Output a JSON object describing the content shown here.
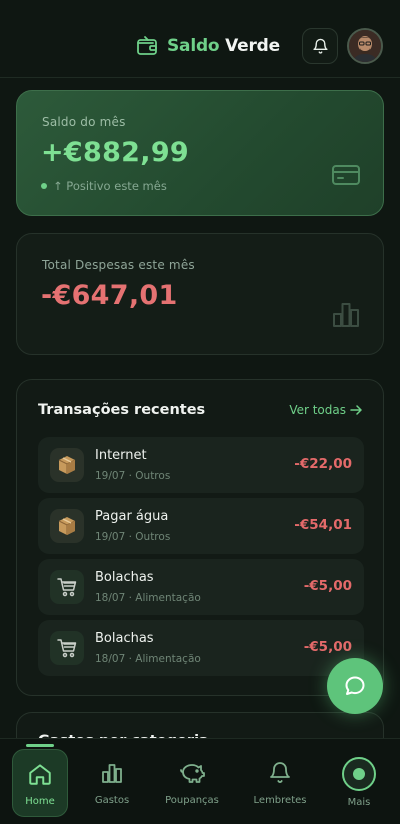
{
  "header": {
    "brand_part1": "Saldo",
    "brand_part2": "Verde",
    "icons": [
      "wallet-icon",
      "bell-icon"
    ]
  },
  "balance_card": {
    "label": "Saldo do mês",
    "amount": "+€882,99",
    "status": "↑ Positivo este mês",
    "icon": "credit-card-icon"
  },
  "expense_card": {
    "label": "Total Despesas este mês",
    "amount": "-€647,01",
    "icon": "bar-chart-icon"
  },
  "transactions": {
    "title": "Transações recentes",
    "see_all": "Ver todas",
    "items": [
      {
        "name": "Internet",
        "meta": "19/07 · Outros",
        "amount": "-€22,00",
        "icon": "package-icon"
      },
      {
        "name": "Pagar água",
        "meta": "19/07 · Outros",
        "amount": "-€54,01",
        "icon": "package-icon"
      },
      {
        "name": "Bolachas",
        "meta": "18/07 · Alimentação",
        "amount": "-€5,00",
        "icon": "cart-icon"
      },
      {
        "name": "Bolachas",
        "meta": "18/07 · Alimentação",
        "amount": "-€5,00",
        "icon": "cart-icon"
      }
    ]
  },
  "next_section": {
    "title": "Gastos por categoria"
  },
  "tabbar": {
    "items": [
      {
        "label": "Home",
        "icon": "home-icon"
      },
      {
        "label": "Gastos",
        "icon": "bar-chart-icon"
      },
      {
        "label": "Poupanças",
        "icon": "piggy-bank-icon"
      },
      {
        "label": "Lembretes",
        "icon": "bell-icon"
      },
      {
        "label": "Mais",
        "icon": "more-icon"
      }
    ]
  },
  "colors": {
    "accent": "#6fd089",
    "positive": "#7ee093",
    "negative": "#e57272",
    "background": "#0f1712"
  }
}
